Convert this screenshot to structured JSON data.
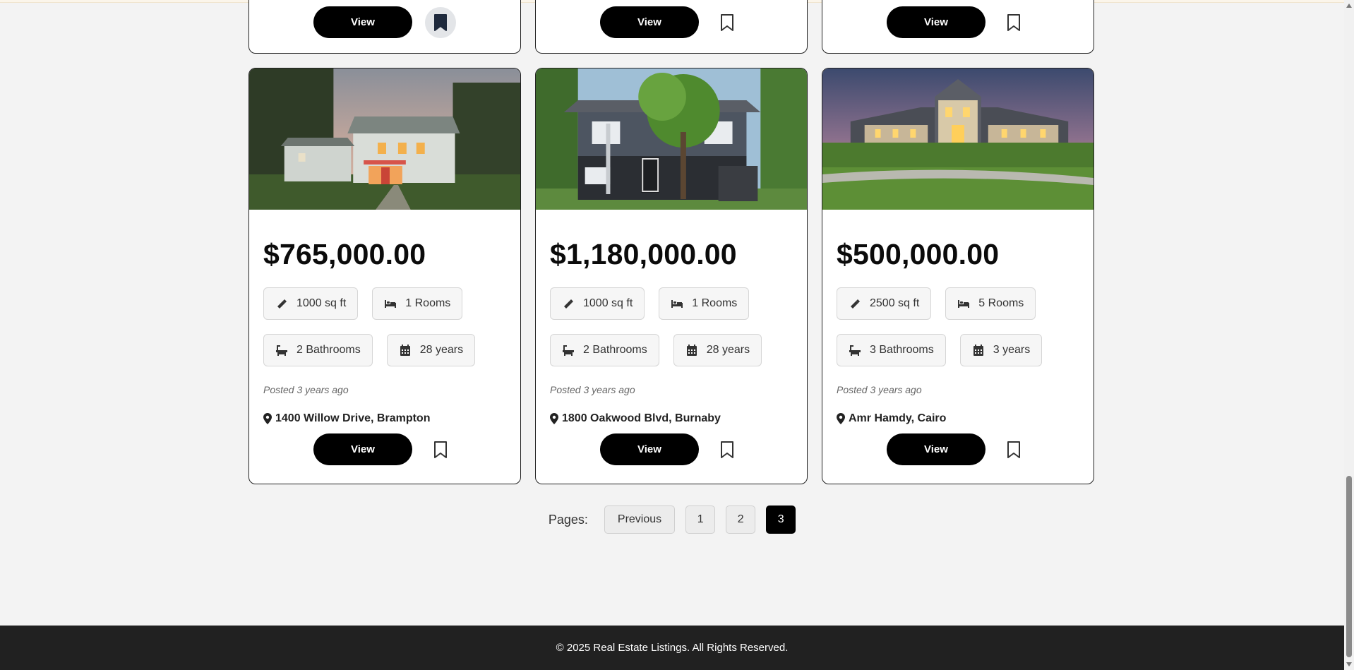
{
  "top_row_cards": [
    {
      "view_label": "View",
      "bookmarked": true
    },
    {
      "view_label": "View",
      "bookmarked": false
    },
    {
      "view_label": "View",
      "bookmarked": false
    }
  ],
  "listings": [
    {
      "price": "$765,000.00",
      "area": "1000 sq ft",
      "rooms": "1 Rooms",
      "bathrooms": "2 Bathrooms",
      "age": "28 years",
      "posted": "Posted 3 years ago",
      "address": "1400 Willow Drive, Brampton",
      "view_label": "View",
      "bookmarked": false
    },
    {
      "price": "$1,180,000.00",
      "area": "1000 sq ft",
      "rooms": "1 Rooms",
      "bathrooms": "2 Bathrooms",
      "age": "28 years",
      "posted": "Posted 3 years ago",
      "address": "1800 Oakwood Blvd, Burnaby",
      "view_label": "View",
      "bookmarked": false
    },
    {
      "price": "$500,000.00",
      "area": "2500 sq ft",
      "rooms": "5 Rooms",
      "bathrooms": "3 Bathrooms",
      "age": "3 years",
      "posted": "Posted 3 years ago",
      "address": "Amr Hamdy, Cairo",
      "view_label": "View",
      "bookmarked": false
    }
  ],
  "pagination": {
    "label": "Pages:",
    "previous": "Previous",
    "pages": [
      "1",
      "2",
      "3"
    ],
    "current": "3"
  },
  "footer": {
    "text": "© 2025 Real Estate Listings. All Rights Reserved."
  },
  "icons": {
    "area": "ruler-icon",
    "rooms": "bed-icon",
    "bathrooms": "bath-icon",
    "age": "calendar-icon",
    "address": "map-pin-icon",
    "bookmark": "bookmark-icon"
  },
  "colors": {
    "page_bg": "#f3f3f3",
    "button": "#000000",
    "footer_bg": "#212121",
    "active_page": "#000000"
  }
}
